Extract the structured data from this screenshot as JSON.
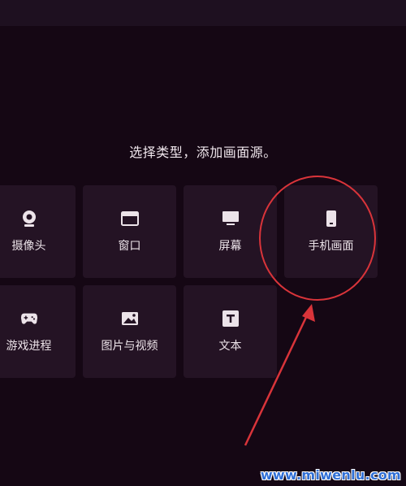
{
  "prompt": "选择类型，添加画面源。",
  "sources": [
    {
      "label": "摄像头",
      "icon": "webcam-icon"
    },
    {
      "label": "窗口",
      "icon": "window-icon"
    },
    {
      "label": "屏幕",
      "icon": "monitor-icon"
    },
    {
      "label": "手机画面",
      "icon": "phone-icon"
    },
    {
      "label": "游戏进程",
      "icon": "gamepad-icon"
    },
    {
      "label": "图片与视频",
      "icon": "image-icon"
    },
    {
      "label": "文本",
      "icon": "text-icon"
    }
  ],
  "highlight": {
    "color": "#d9343a",
    "target": "手机画面"
  },
  "watermark": "www.miwenlu.com"
}
